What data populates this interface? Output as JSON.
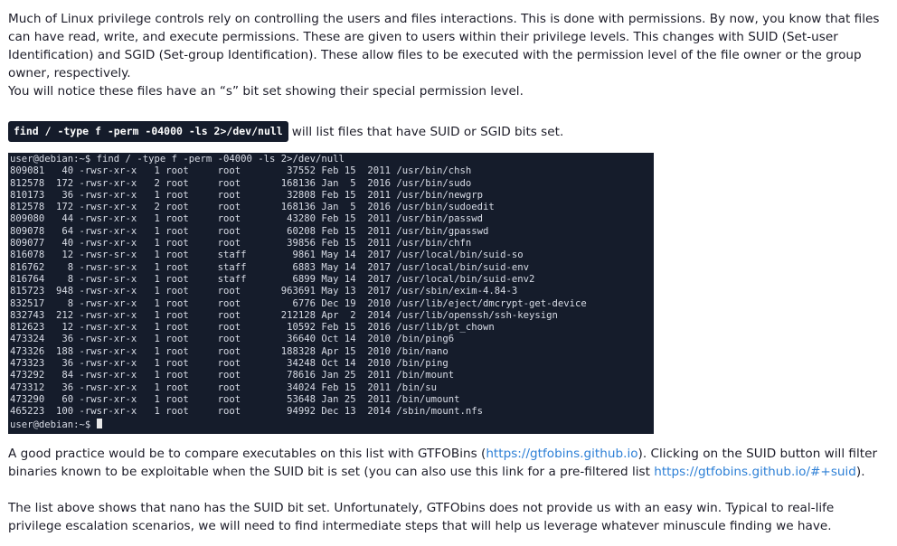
{
  "intro": {
    "text": "Much of Linux privilege controls rely on controlling the users and files interactions. This is done with permissions. By now, you know that files can have read, write, and execute permissions. These are given to users within their privilege levels. This changes with SUID (Set-user Identification) and SGID (Set-group Identification). These allow files to be executed with the permission level of the file owner or the group owner, respectively."
  },
  "notice": {
    "text": "You will notice these files have an “s” bit set showing their special permission level."
  },
  "command": {
    "code": "find / -type f -perm -04000 -ls 2>/dev/null",
    "suffix": "will list files that have SUID or SGID bits set."
  },
  "terminal": {
    "prompt_command": "user@debian:~$ find / -type f -perm -04000 -ls 2>/dev/null",
    "lines": [
      "809081   40 -rwsr-xr-x   1 root     root        37552 Feb 15  2011 /usr/bin/chsh",
      "812578  172 -rwsr-xr-x   2 root     root       168136 Jan  5  2016 /usr/bin/sudo",
      "810173   36 -rwsr-xr-x   1 root     root        32808 Feb 15  2011 /usr/bin/newgrp",
      "812578  172 -rwsr-xr-x   2 root     root       168136 Jan  5  2016 /usr/bin/sudoedit",
      "809080   44 -rwsr-xr-x   1 root     root        43280 Feb 15  2011 /usr/bin/passwd",
      "809078   64 -rwsr-xr-x   1 root     root        60208 Feb 15  2011 /usr/bin/gpasswd",
      "809077   40 -rwsr-xr-x   1 root     root        39856 Feb 15  2011 /usr/bin/chfn",
      "816078   12 -rwsr-sr-x   1 root     staff        9861 May 14  2017 /usr/local/bin/suid-so",
      "816762    8 -rwsr-sr-x   1 root     staff        6883 May 14  2017 /usr/local/bin/suid-env",
      "816764    8 -rwsr-sr-x   1 root     staff        6899 May 14  2017 /usr/local/bin/suid-env2",
      "815723  948 -rwsr-xr-x   1 root     root       963691 May 13  2017 /usr/sbin/exim-4.84-3",
      "832517    8 -rwsr-xr-x   1 root     root         6776 Dec 19  2010 /usr/lib/eject/dmcrypt-get-device",
      "832743  212 -rwsr-xr-x   1 root     root       212128 Apr  2  2014 /usr/lib/openssh/ssh-keysign",
      "812623   12 -rwsr-xr-x   1 root     root        10592 Feb 15  2016 /usr/lib/pt_chown",
      "473324   36 -rwsr-xr-x   1 root     root        36640 Oct 14  2010 /bin/ping6",
      "473326  188 -rwsr-xr-x   1 root     root       188328 Apr 15  2010 /bin/nano",
      "473323   36 -rwsr-xr-x   1 root     root        34248 Oct 14  2010 /bin/ping",
      "473292   84 -rwsr-xr-x   1 root     root        78616 Jan 25  2011 /bin/mount",
      "473312   36 -rwsr-xr-x   1 root     root        34024 Feb 15  2011 /bin/su",
      "473290   60 -rwsr-xr-x   1 root     root        53648 Jan 25  2011 /bin/umount",
      "465223  100 -rwsr-xr-x   1 root     root        94992 Dec 13  2014 /sbin/mount.nfs"
    ],
    "final_prompt": "user@debian:~$ "
  },
  "practice": {
    "before": "A good practice would be to compare executables on this list with GTFOBins (",
    "link1": "https://gtfobins.github.io",
    "middle": "). Clicking on the SUID button will filter binaries known to be exploitable when the SUID bit is set (you can also use this link for a pre-filtered list ",
    "link2": "https://gtfobins.github.io/#+suid",
    "after": ")."
  },
  "conclusion": {
    "text": "The list above shows that nano has the SUID bit set. Unfortunately, GTFObins does not provide us with an easy win. Typical to real-life privilege escalation scenarios, we will need to find intermediate steps that will help us leverage whatever minuscule finding we have."
  }
}
